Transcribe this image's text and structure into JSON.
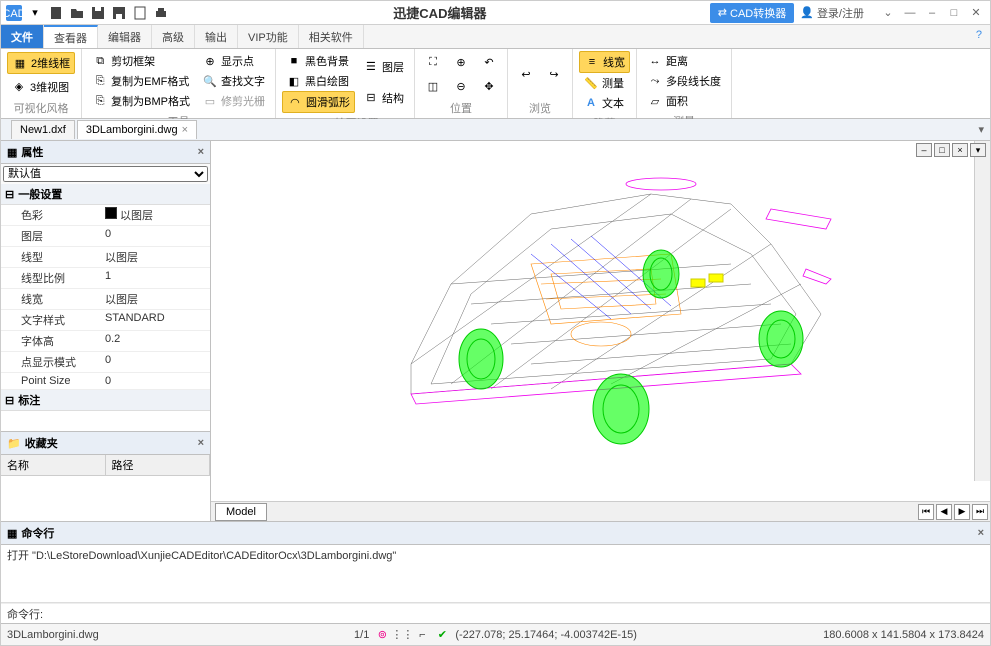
{
  "app_title": "迅捷CAD编辑器",
  "qat_icons": [
    "cad-logo",
    "chevron-down",
    "new-file",
    "open-folder",
    "save",
    "save-as",
    "export",
    "print"
  ],
  "titlebar_right": {
    "cad_convert": "CAD转换器",
    "login": "登录/注册"
  },
  "menu_tabs": {
    "file": "文件",
    "items": [
      "查看器",
      "编辑器",
      "高级",
      "输出",
      "VIP功能",
      "相关软件"
    ],
    "active_index": 0
  },
  "ribbon": {
    "groups": [
      {
        "label": "可视化风格",
        "items": [
          {
            "k": "2d",
            "t": "2维线框",
            "active": true
          },
          {
            "k": "3d",
            "t": "3维视图"
          }
        ]
      },
      {
        "label": "工具",
        "items": [
          {
            "k": "clip",
            "t": "剪切框架"
          },
          {
            "k": "emf",
            "t": "复制为EMF格式"
          },
          {
            "k": "bmp",
            "t": "复制为BMP格式"
          },
          {
            "k": "showpt",
            "t": "显示点"
          },
          {
            "k": "findtxt",
            "t": "查找文字"
          },
          {
            "k": "trimlw",
            "t": "修剪光栅"
          }
        ]
      },
      {
        "label": "CAD绘图设置",
        "items": [
          {
            "k": "blackbg",
            "t": "黑色背景"
          },
          {
            "k": "bwdrw",
            "t": "黑白绘图"
          },
          {
            "k": "arc",
            "t": "圆滑弧形",
            "active": true
          },
          {
            "k": "layers",
            "t": "图层"
          },
          {
            "k": "struct",
            "t": "结构"
          }
        ]
      },
      {
        "label": "位置",
        "items": []
      },
      {
        "label": "浏览",
        "items": []
      },
      {
        "label": "隐藏",
        "items": [
          {
            "k": "lw",
            "t": "线宽"
          },
          {
            "k": "meas",
            "t": "测量"
          },
          {
            "k": "text",
            "t": "文本"
          }
        ]
      },
      {
        "label": "测量",
        "items": [
          {
            "k": "dist",
            "t": "距离"
          },
          {
            "k": "polylen",
            "t": "多段线长度"
          },
          {
            "k": "area",
            "t": "面积"
          }
        ]
      }
    ]
  },
  "doc_tabs": [
    {
      "name": "New1.dxf",
      "active": false
    },
    {
      "name": "3DLamborgini.dwg",
      "active": true
    }
  ],
  "properties_panel": {
    "title": "属性",
    "selector": "默认值",
    "section": "一般设置",
    "rows": [
      {
        "k": "色彩",
        "v": "以图层",
        "swatch": true
      },
      {
        "k": "图层",
        "v": "0"
      },
      {
        "k": "线型",
        "v": "以图层"
      },
      {
        "k": "线型比例",
        "v": "1"
      },
      {
        "k": "线宽",
        "v": "以图层"
      },
      {
        "k": "文字样式",
        "v": "STANDARD"
      },
      {
        "k": "字体高",
        "v": "0.2"
      },
      {
        "k": "点显示模式",
        "v": "0"
      },
      {
        "k": "Point Size",
        "v": "0"
      }
    ],
    "section2": "标注"
  },
  "favorites_panel": {
    "title": "收藏夹",
    "cols": [
      "名称",
      "路径"
    ]
  },
  "model_tab": "Model",
  "cmd_panel": {
    "title": "命令行",
    "log": "打开 \"D:\\LeStoreDownload\\XunjieCADEditor\\CADEditorOcx\\3DLamborgini.dwg\"",
    "prompt": "命令行:"
  },
  "statusbar": {
    "file": "3DLamborgini.dwg",
    "zoom": "1/1",
    "coords": "(-227.078; 25.17464; -4.003742E-15)",
    "size": "180.6008 x 141.5804 x 173.8424"
  }
}
